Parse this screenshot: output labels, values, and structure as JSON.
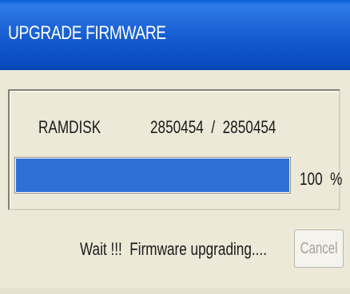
{
  "window": {
    "title": "UPGRADE FIRMWARE"
  },
  "progress": {
    "file_name": "RAMDISK",
    "bytes_done": "2850454",
    "separator": "/",
    "bytes_total": "2850454",
    "byte_count_text": "2850454  /  2850454",
    "percent_value": 100,
    "percent_text": "100  %"
  },
  "status": {
    "message": "Wait !!!  Firmware upgrading...."
  },
  "buttons": {
    "cancel_label": "Cancel",
    "cancel_enabled": false
  },
  "colors": {
    "titlebar": "#0B4FC5",
    "progress_fill": "#2F6FD6",
    "dialog_bg": "#ECE9D8"
  }
}
